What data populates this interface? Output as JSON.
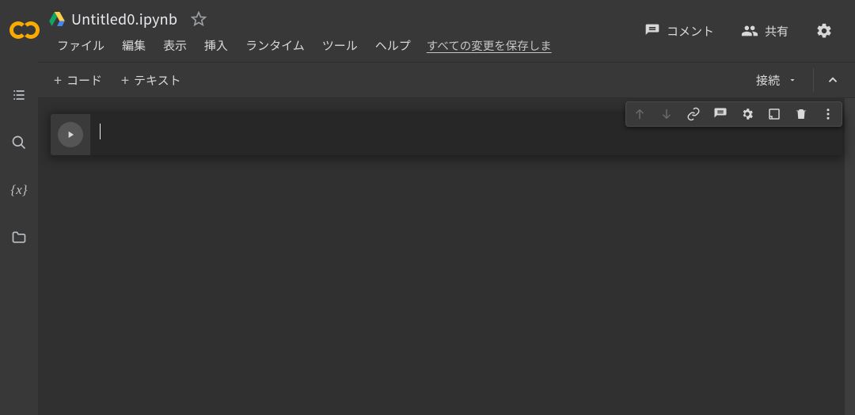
{
  "header": {
    "doc_title": "Untitled0.ipynb",
    "menus": [
      "ファイル",
      "編集",
      "表示",
      "挿入",
      "ランタイム",
      "ツール",
      "ヘルプ"
    ],
    "save_status": "すべての変更を保存しま",
    "comment_label": "コメント",
    "share_label": "共有"
  },
  "toolbar": {
    "code_label": "コード",
    "text_label": "テキスト",
    "connect_label": "接続"
  },
  "cell": {
    "code": ""
  }
}
